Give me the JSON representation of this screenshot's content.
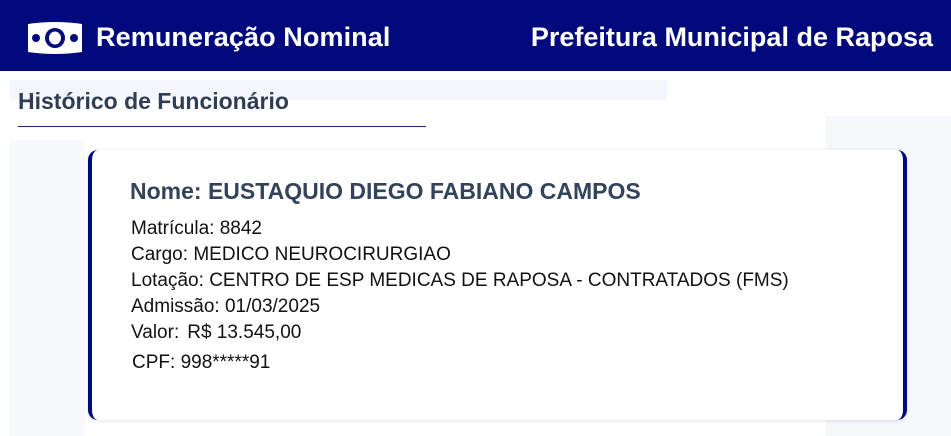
{
  "header": {
    "logo_icon": "money-bill-icon",
    "title": "Remuneração Nominal",
    "organization": "Prefeitura Municipal de Raposa",
    "background_color": "#000a7c"
  },
  "section": {
    "title": "Histórico de Funcionário"
  },
  "employee": {
    "name_label": "Nome:",
    "name": "EUSTAQUIO DIEGO FABIANO CAMPOS",
    "matricula_label": "Matrícula:",
    "matricula": "8842",
    "cargo_label": "Cargo:",
    "cargo": "MEDICO NEUROCIRURGIAO",
    "lotacao_label": "Lotação:",
    "lotacao": "CENTRO DE ESP MEDICAS DE RAPOSA - CONTRATADOS (FMS)",
    "admissao_label": "Admissão:",
    "admissao": "01/03/2025",
    "valor_label": "Valor:",
    "valor": "R$ 13.545,00",
    "cpf_label": "CPF:",
    "cpf": "998*****91"
  }
}
